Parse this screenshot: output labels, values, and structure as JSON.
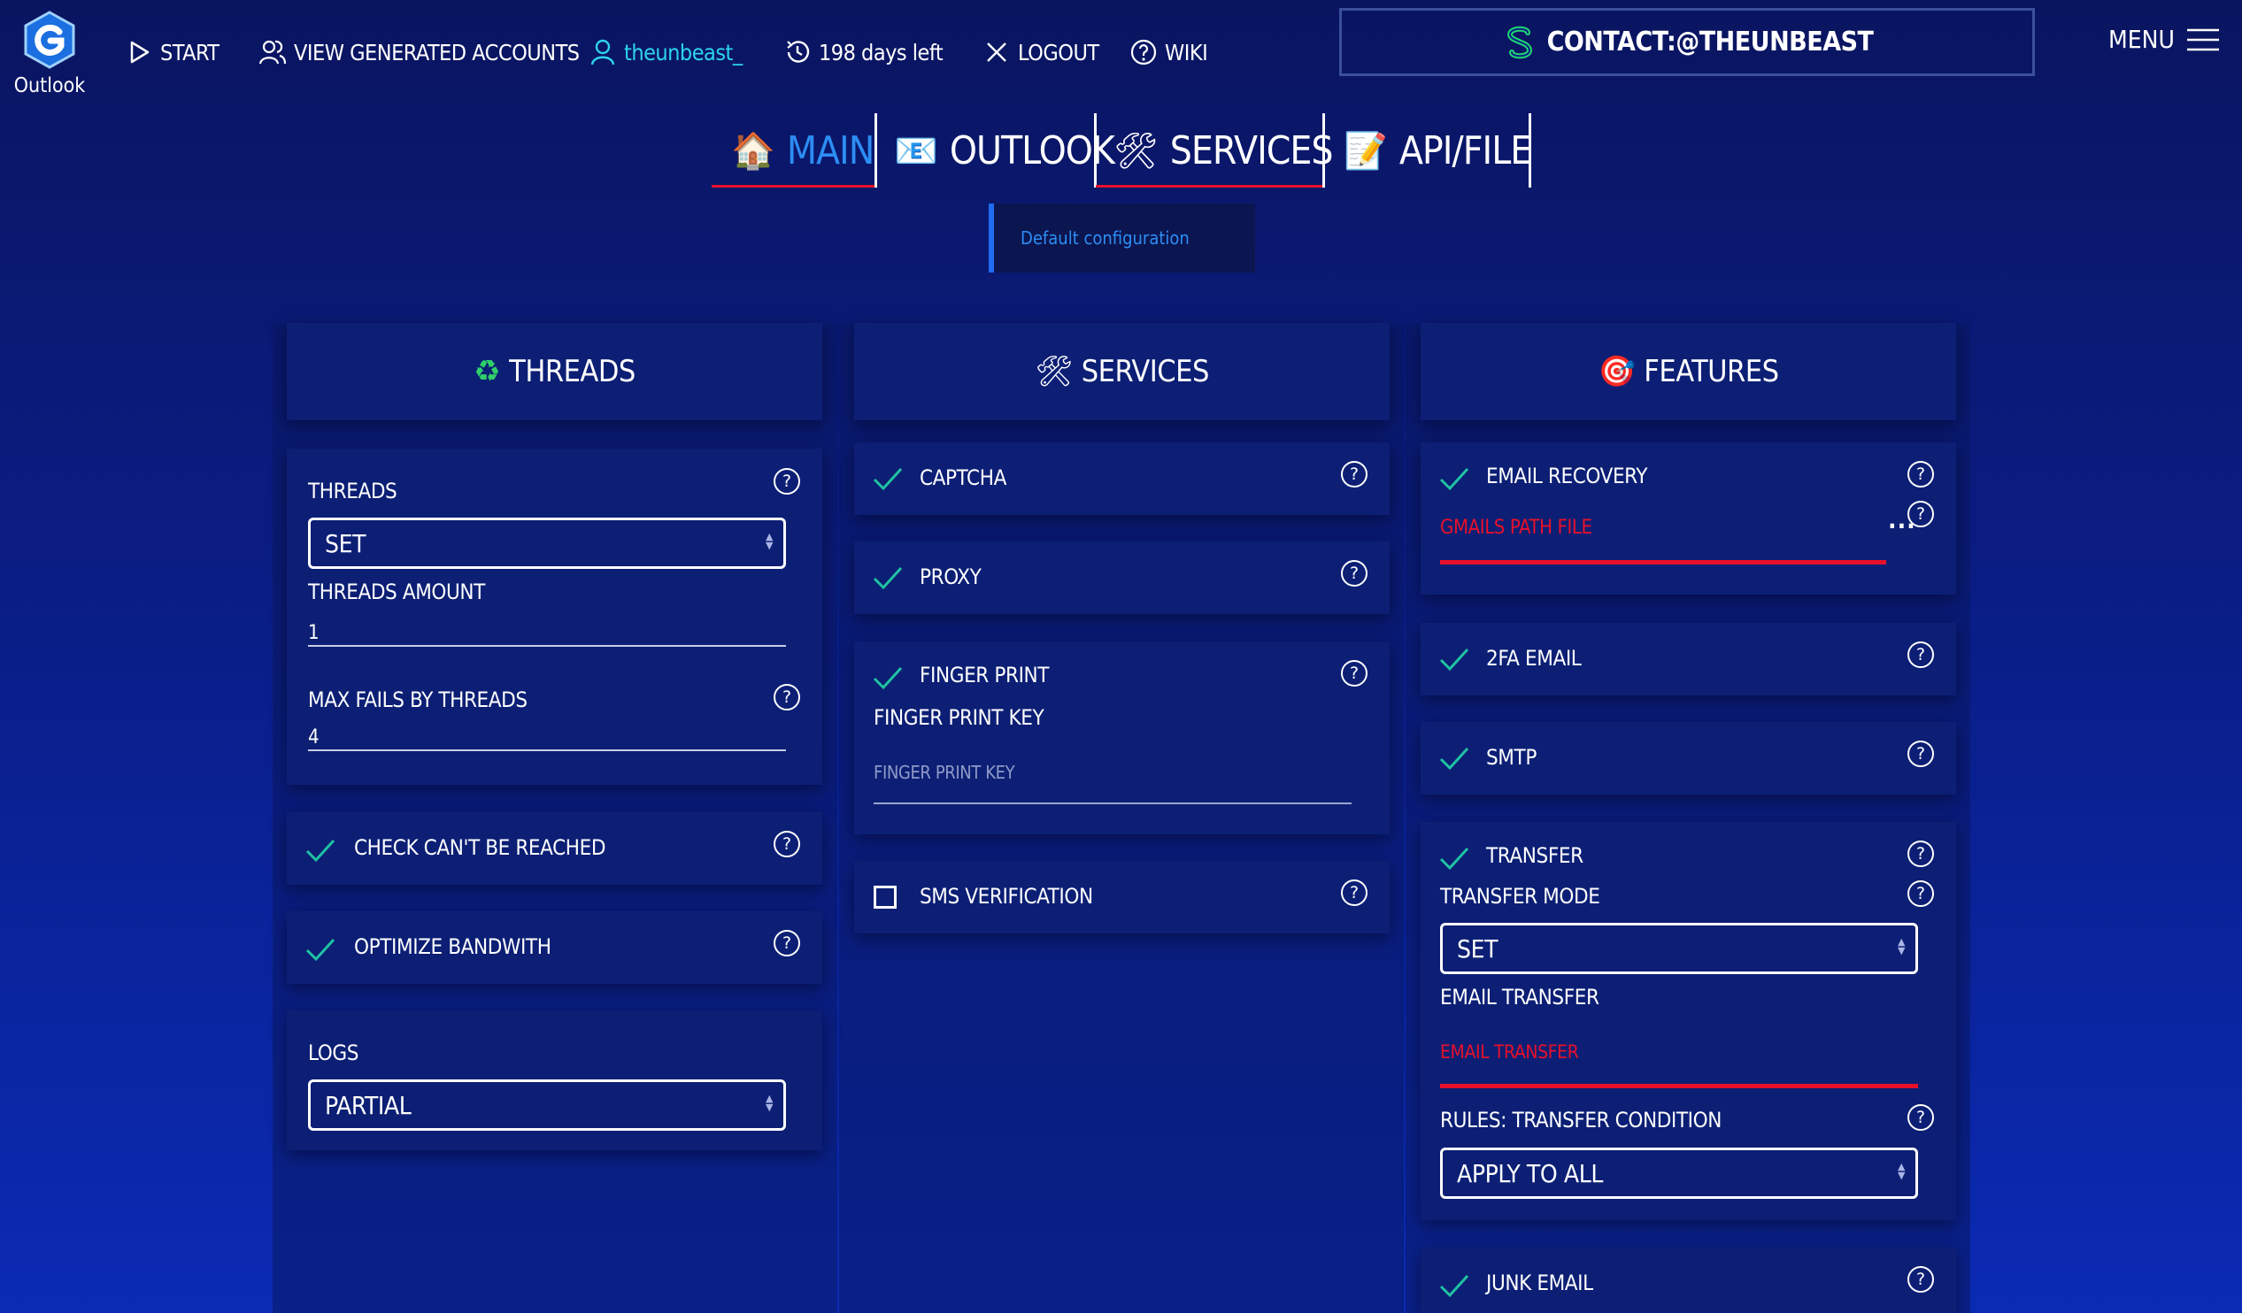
{
  "colors": {
    "accent_cyan": "#2dd4ee",
    "accent_red": "#e8102a",
    "check_green": "#20c3a2",
    "link_blue": "#2d8df4"
  },
  "brand": {
    "label": "Outlook"
  },
  "nav": {
    "start": "START",
    "view_accounts": "VIEW GENERATED ACCOUNTS",
    "username": "theunbeast_",
    "days_left": "198 days left",
    "logout": "LOGOUT",
    "wiki": "WIKI"
  },
  "contact": {
    "label": "CONTACT:@THEUNBEAST"
  },
  "menu": {
    "label": "MENU"
  },
  "tabs": [
    {
      "label": "MAIN",
      "icon": "house-icon"
    },
    {
      "label": "OUTLOOK",
      "icon": "email-icon"
    },
    {
      "label": "SERVICES",
      "icon": "tools-icon"
    },
    {
      "label": "API/FILE",
      "icon": "memo-icon"
    }
  ],
  "config": {
    "label": "Default configuration"
  },
  "threads_col": {
    "title": "THREADS",
    "threads_label": "THREADS",
    "threads_select": "SET",
    "threads_amount_label": "THREADS AMOUNT",
    "threads_amount_value": "1",
    "max_fails_label": "MAX FAILS BY THREADS",
    "max_fails_value": "4",
    "check_unreachable": "CHECK CAN'T BE REACHED",
    "optimize_bandwidth": "OPTIMIZE BANDWITH",
    "logs_label": "LOGS",
    "logs_select": "PARTIAL"
  },
  "services_col": {
    "title": "SERVICES",
    "captcha": "CAPTCHA",
    "proxy": "PROXY",
    "finger_print": "FINGER PRINT",
    "finger_print_key_label": "FINGER PRINT KEY",
    "finger_print_key_placeholder": "FINGER PRINT KEY",
    "sms_verification": "SMS VERIFICATION"
  },
  "features_col": {
    "title": "FEATURES",
    "email_recovery": "EMAIL RECOVERY",
    "gmails_path_placeholder": "GMAILS PATH FILE",
    "email_2fa": "2FA EMAIL",
    "smtp": "SMTP",
    "transfer": "TRANSFER",
    "transfer_mode_label": "TRANSFER MODE",
    "transfer_mode_select": "SET",
    "email_transfer_label": "EMAIL TRANSFER",
    "email_transfer_placeholder": "EMAIL TRANSFER",
    "rules_label": "RULES: TRANSFER CONDITION",
    "rules_select": "APPLY TO ALL",
    "junk_email": "JUNK EMAIL"
  }
}
